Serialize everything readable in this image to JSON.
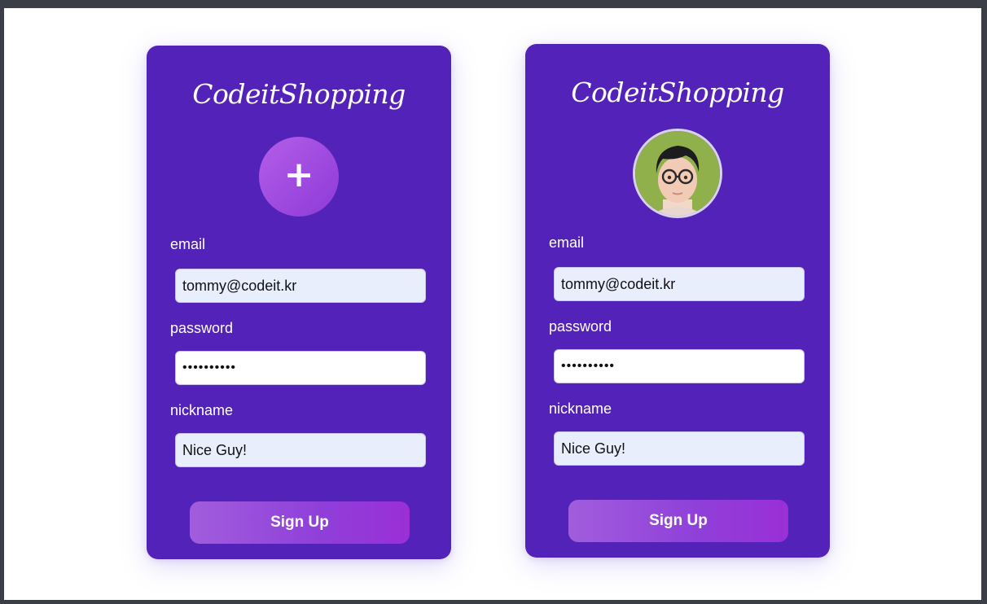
{
  "cards": [
    {
      "brand": "CodeitShopping",
      "avatar": {
        "state": "empty",
        "icon": "plus-icon",
        "glyph": "+"
      },
      "fields": {
        "email": {
          "label": "email",
          "value": "tommy@codeit.kr"
        },
        "password": {
          "label": "password",
          "value": "••••••••••"
        },
        "nickname": {
          "label": "nickname",
          "value": "Nice Guy!"
        }
      },
      "submit_label": "Sign Up"
    },
    {
      "brand": "CodeitShopping",
      "avatar": {
        "state": "uploaded",
        "icon": "profile-photo"
      },
      "fields": {
        "email": {
          "label": "email",
          "value": "tommy@codeit.kr"
        },
        "password": {
          "label": "password",
          "value": "••••••••••"
        },
        "nickname": {
          "label": "nickname",
          "value": "Nice Guy!"
        }
      },
      "submit_label": "Sign Up"
    }
  ],
  "colors": {
    "card": "#5322b8",
    "accent": "#9b4ee0",
    "input_bg": "#e8eefb",
    "frame": "#3b3d47"
  }
}
